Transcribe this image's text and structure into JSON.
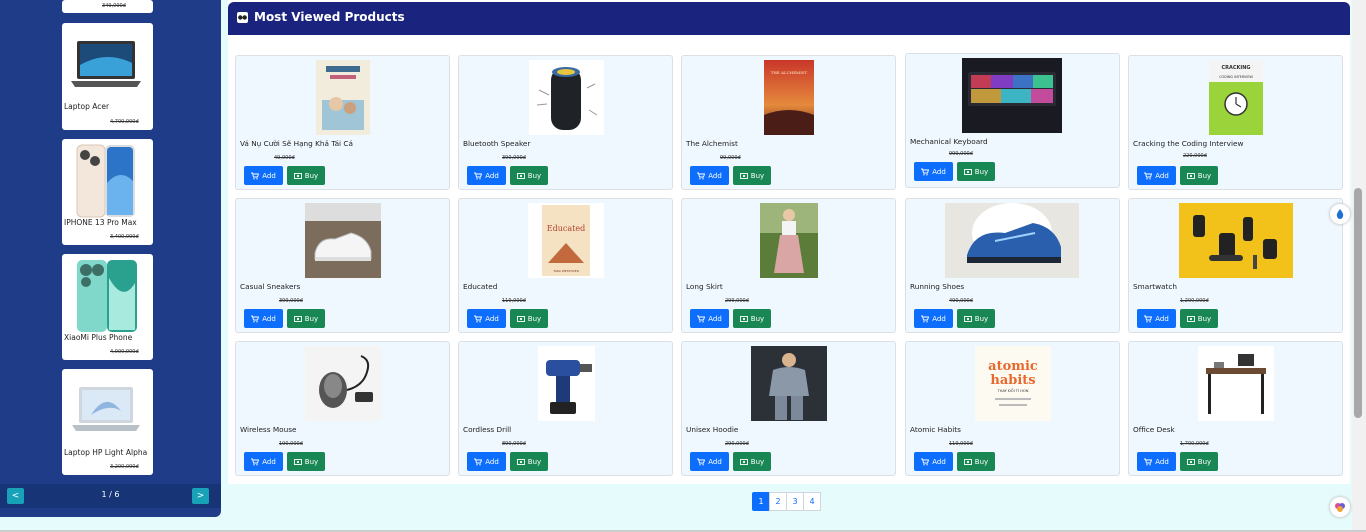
{
  "sidebar": {
    "items": [
      {
        "name": "",
        "price": "",
        "old_price": "349,000đ"
      },
      {
        "name": "Laptop Acer",
        "price": "",
        "old_price": "4,700,000đ"
      },
      {
        "name": "IPHONE 13 Pro Max",
        "price": "",
        "old_price": "3,400,000đ"
      },
      {
        "name": "XiaoMi Plus Phone",
        "price": "",
        "old_price": "4,000,000đ"
      },
      {
        "name": "Laptop HP Light Alpha",
        "price": "",
        "old_price": "3,200,000đ"
      }
    ],
    "pager": {
      "prev": "<",
      "info": "1 / 6",
      "next": ">"
    }
  },
  "section": {
    "title": "Most Viewed Products"
  },
  "buttons": {
    "add": "Add",
    "buy": "Buy"
  },
  "products": [
    {
      "name": "Vá Nụ Cười Sẽ Hạng Khả Tái Cá",
      "price": "",
      "old_price": "49,000đ"
    },
    {
      "name": "Bluetooth Speaker",
      "price": "",
      "old_price": "390,000đ"
    },
    {
      "name": "The Alchemist",
      "price": "",
      "old_price": "99,000đ"
    },
    {
      "name": "Mechanical Keyboard",
      "price": "",
      "old_price": "999,000đ"
    },
    {
      "name": "Cracking the Coding Interview",
      "price": "",
      "old_price": "220,000đ"
    },
    {
      "name": "Casual Sneakers",
      "price": "",
      "old_price": "399,000đ"
    },
    {
      "name": "Educated",
      "price": "",
      "old_price": "119,000đ"
    },
    {
      "name": "Long Skirt",
      "price": "",
      "old_price": "299,000đ"
    },
    {
      "name": "Running Shoes",
      "price": "",
      "old_price": "490,000đ"
    },
    {
      "name": "Smartwatch",
      "price": "",
      "old_price": "1,200,000đ"
    },
    {
      "name": "Wireless Mouse",
      "price": "",
      "old_price": "190,000đ"
    },
    {
      "name": "Cordless Drill",
      "price": "",
      "old_price": "890,000đ"
    },
    {
      "name": "Unisex Hoodie",
      "price": "",
      "old_price": "290,000đ"
    },
    {
      "name": "Atomic Habits",
      "price": "",
      "old_price": "119,000đ"
    },
    {
      "name": "Office Desk",
      "price": "",
      "old_price": "1,700,000đ"
    }
  ],
  "book_texts": {
    "alchemist": "THE ALCHEMIST",
    "cracking_1": "CRACKING",
    "cracking_2": "CODING INTERVIEW",
    "educated": "Educated",
    "educated_author": "TARA WESTOVER",
    "atomic_1": "atomic",
    "atomic_2": "habits",
    "atomic_sub": "THAY ĐỔI TÍ HON"
  },
  "pagination": [
    "1",
    "2",
    "3",
    "4"
  ],
  "colors": {
    "primary": "#0d6efd",
    "success": "#198754",
    "header": "#1a237e",
    "sidebar": "#1f3c88"
  }
}
